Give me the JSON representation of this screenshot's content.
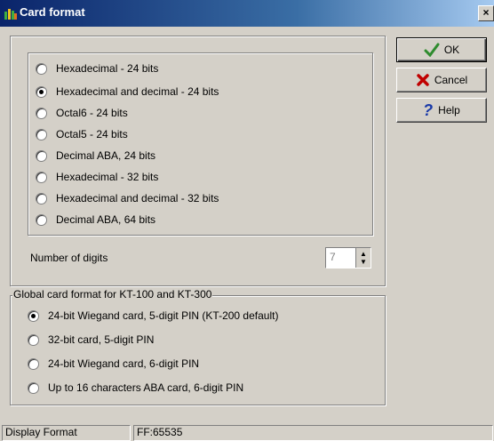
{
  "window": {
    "title": "Card format",
    "close_label": "×"
  },
  "format_options": [
    {
      "label": "Hexadecimal - 24 bits",
      "checked": false
    },
    {
      "label": "Hexadecimal and decimal - 24 bits",
      "checked": true
    },
    {
      "label": "Octal6 - 24 bits",
      "checked": false
    },
    {
      "label": "Octal5 - 24 bits",
      "checked": false
    },
    {
      "label": "Decimal ABA, 24 bits",
      "checked": false
    },
    {
      "label": "Hexadecimal - 32 bits",
      "checked": false
    },
    {
      "label": "Hexadecimal and decimal - 32 bits",
      "checked": false
    },
    {
      "label": "Decimal ABA, 64 bits",
      "checked": false
    }
  ],
  "digits": {
    "label": "Number of digits",
    "value": "7",
    "up_icon": "up-arrow",
    "down_icon": "down-arrow"
  },
  "global_group": {
    "title": "Global card format for KT-100 and KT-300",
    "options": [
      {
        "label": "24-bit Wiegand card, 5-digit PIN (KT-200 default)",
        "checked": true
      },
      {
        "label": "32-bit card, 5-digit PIN",
        "checked": false
      },
      {
        "label": "24-bit Wiegand card, 6-digit PIN",
        "checked": false
      },
      {
        "label": "Up to 16 characters ABA card, 6-digit PIN",
        "checked": false
      }
    ]
  },
  "buttons": {
    "ok": {
      "label": "OK",
      "icon": "check-icon",
      "color": "#2e8b2e"
    },
    "cancel": {
      "label": "Cancel",
      "icon": "x-icon",
      "color": "#c00000"
    },
    "help": {
      "label": "Help",
      "icon": "question-icon",
      "color": "#1a3aa8"
    }
  },
  "status": {
    "left": "Display Format",
    "right": "FF:65535"
  }
}
